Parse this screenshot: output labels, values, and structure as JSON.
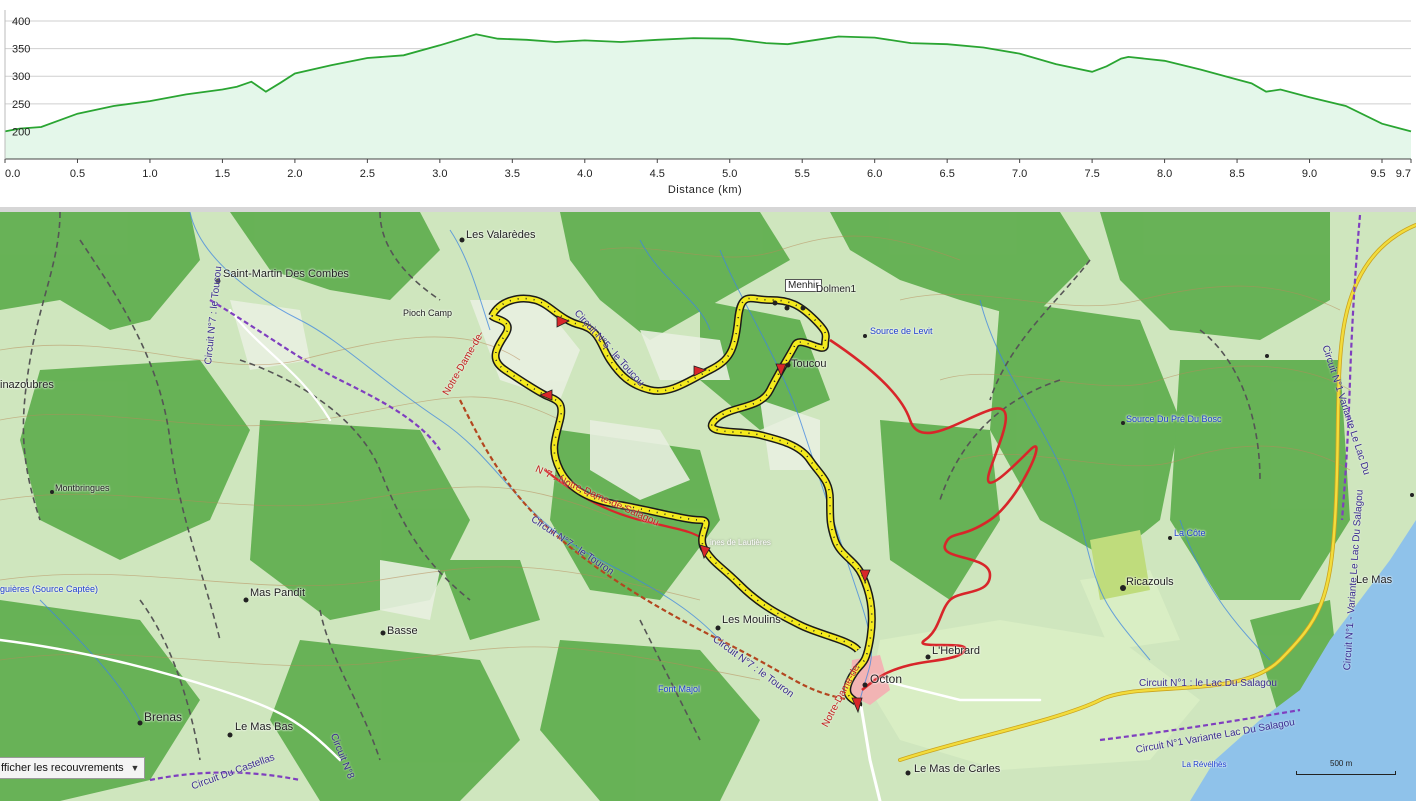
{
  "profile": {
    "y_ticks": [
      "400",
      "350",
      "300",
      "250",
      "200"
    ],
    "x_ticks": [
      "0.0",
      "0.5",
      "1.0",
      "1.5",
      "2.0",
      "2.5",
      "3.0",
      "3.5",
      "4.0",
      "4.5",
      "5.0",
      "5.5",
      "6.0",
      "6.5",
      "7.0",
      "7.5",
      "8.0",
      "8.5",
      "9.0",
      "9.5",
      "9.7"
    ],
    "x_axis_title": "Distance  (km)",
    "line_color": "#2aa532",
    "fill_color": "#e4f7ea"
  },
  "chart_data": {
    "type": "area",
    "title": "",
    "xlabel": "Distance  (km)",
    "ylabel": "",
    "xlim": [
      0,
      9.7
    ],
    "ylim": [
      150,
      420
    ],
    "grid": true,
    "x": [
      0,
      0.1,
      0.25,
      0.5,
      0.75,
      1.0,
      1.25,
      1.5,
      1.6,
      1.7,
      1.8,
      1.9,
      2.0,
      2.25,
      2.5,
      2.75,
      3.0,
      3.25,
      3.4,
      3.6,
      3.8,
      4.0,
      4.25,
      4.5,
      4.75,
      5.0,
      5.25,
      5.4,
      5.6,
      5.75,
      6.0,
      6.25,
      6.5,
      6.75,
      7.0,
      7.25,
      7.5,
      7.6,
      7.7,
      7.75,
      8.0,
      8.25,
      8.5,
      8.6,
      8.7,
      8.8,
      9.0,
      9.25,
      9.5,
      9.7
    ],
    "series": [
      {
        "values": [
          200,
          205,
          208,
          232,
          246,
          255,
          267,
          276,
          281,
          290,
          272,
          288,
          305,
          320,
          333,
          338,
          356,
          376,
          368,
          366,
          362,
          365,
          362,
          366,
          369,
          368,
          360,
          358,
          366,
          372,
          370,
          360,
          358,
          352,
          341,
          322,
          308,
          318,
          332,
          335,
          328,
          312,
          294,
          287,
          272,
          276,
          262,
          246,
          214,
          200
        ]
      }
    ]
  },
  "map": {
    "places": {
      "les_valarede": "Les Valarèdes",
      "saint_martin": "Saint-Martin Des Combes",
      "pioch_camp": "Pioch Camp",
      "inazoubres": "inazoubres",
      "montbringues": "Montbringues",
      "guieres": "guières (Source Captée)",
      "mas_pandit": "Mas Pandit",
      "basse": "Basse",
      "brenas": "Brenas",
      "le_mas_bas": "Le Mas Bas",
      "menhir": "Menhir",
      "dolmen": "Dolmen1",
      "toucou": "Toucou",
      "source_levit": "Source de Levit",
      "source_pre_bosc": "Source Du Pré Du Bosc",
      "la_cote": "La Côte",
      "ricazouls": "Ricazouls",
      "le_mas": "Le Mas",
      "l_hebrard": "L'Hebrard",
      "octon": "Octon",
      "les_moulins": "Les Moulins",
      "font_majol": "Font Majol",
      "le_mas_de_carles": "Le Mas de Carles",
      "la_reveilhes": "La Révélhès",
      "barre_lautieres": "ines de Lautières"
    },
    "routes": {
      "circuit_n7_toucou": "Circuit N°7 : le Toucou",
      "circuit_n7_touron_a": "Circuit N°7 : le Touron",
      "circuit_n7_touron_b": "Circuit N°7 : le Touron",
      "notre_dame_a": "Notre-Dame-de-",
      "notre_dame_b": "N°7 : Notre-Dame-de-Salagou",
      "notre_dame_c": "Notre-Dame-de-",
      "circuit_n1_lac": "Circuit N°1 : le Lac Du Salagou",
      "circuit_n1_variante_a": "Circuit N°1 Variante Lac Du Salagou",
      "circuit_n1_variante_b": "Circuit N°1 - Variante Le Lac Du Salagou",
      "circuit_n1_variante_c": "Circuit N°1 Variante Le Lac Du",
      "circuit_n5": "Circuit N°5 : le Toucou",
      "circuit_n8": "Circuit N°8",
      "circuit_castellas": "Circuit Du Castellas"
    },
    "track_color": "#f4ea1e",
    "alt_route_color": "#d8262a"
  },
  "controls": {
    "overlay_select": "fficher les recouvrements",
    "scale_label": "500 m"
  }
}
